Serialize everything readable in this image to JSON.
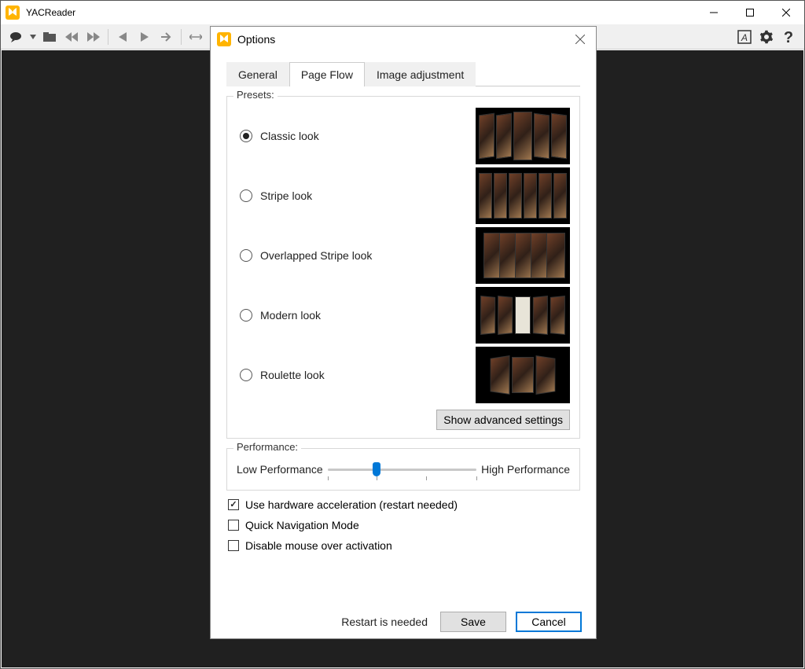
{
  "app": {
    "title": "YACReader"
  },
  "dialog": {
    "title": "Options",
    "tabs": {
      "general": "General",
      "pageflow": "Page Flow",
      "image": "Image adjustment",
      "active": "pageflow"
    },
    "presets": {
      "legend": "Presets:",
      "items": [
        {
          "label": "Classic look",
          "checked": true
        },
        {
          "label": "Stripe look",
          "checked": false
        },
        {
          "label": "Overlapped Stripe look",
          "checked": false
        },
        {
          "label": "Modern look",
          "checked": false
        },
        {
          "label": "Roulette look",
          "checked": false
        }
      ],
      "advanced": "Show advanced settings"
    },
    "performance": {
      "legend": "Performance:",
      "low": "Low Performance",
      "high": "High Performance",
      "value_pct": 33
    },
    "checks": {
      "hwaccel": {
        "label": "Use hardware acceleration (restart needed)",
        "checked": true
      },
      "quicknav": {
        "label": "Quick Navigation Mode",
        "checked": false
      },
      "mouseover": {
        "label": "Disable mouse over activation",
        "checked": false
      }
    },
    "footer": {
      "msg": "Restart is needed",
      "save": "Save",
      "cancel": "Cancel"
    }
  }
}
